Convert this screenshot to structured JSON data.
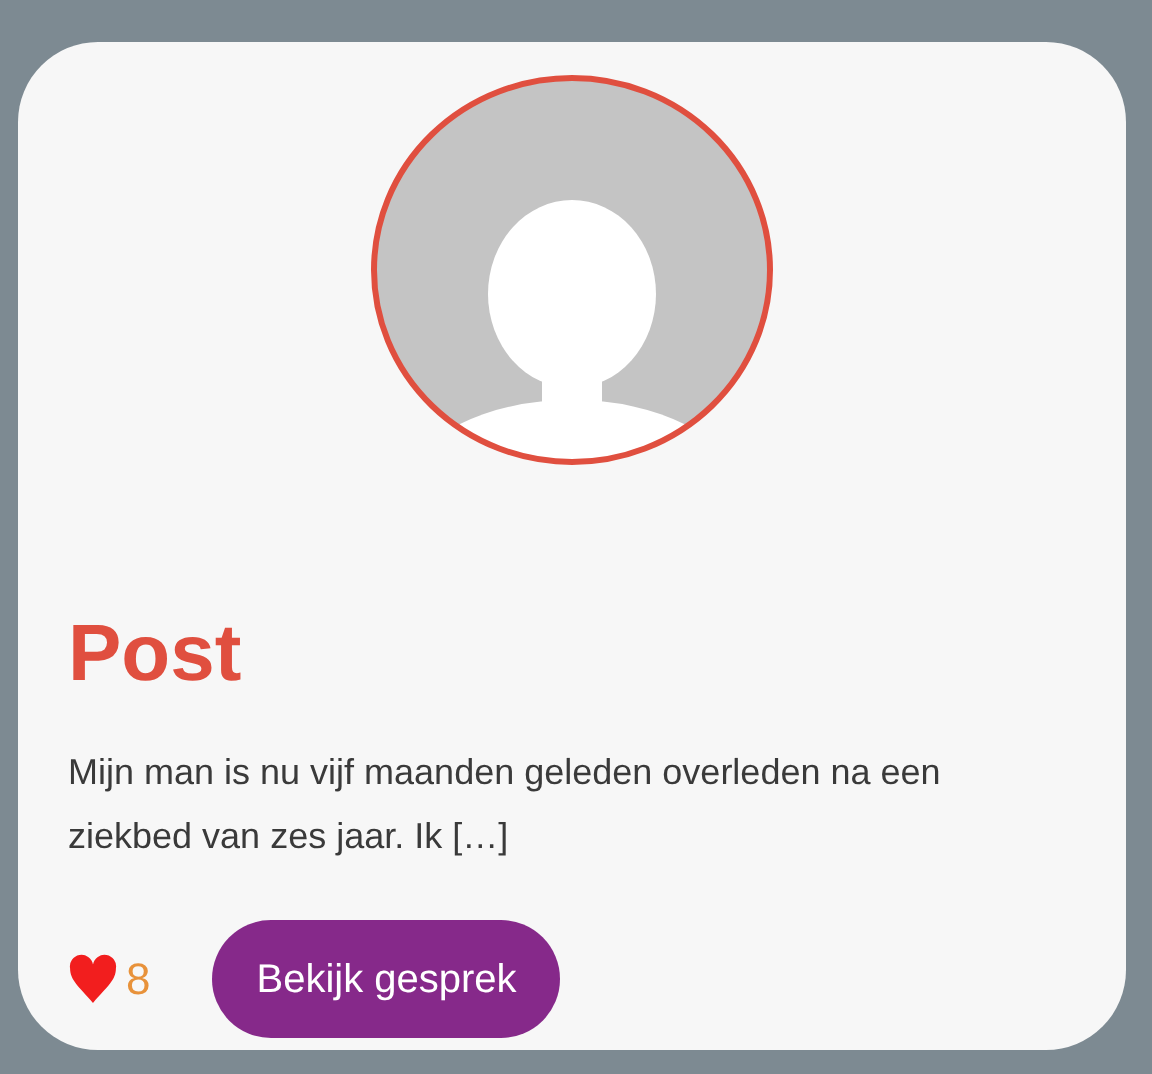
{
  "card": {
    "title": "Post",
    "excerpt": "Mijn man is nu vijf maanden geleden overleden na een ziekbed van zes jaar. Ik […]",
    "likes": {
      "count": "8"
    },
    "button": "Bekijk gesprek"
  }
}
